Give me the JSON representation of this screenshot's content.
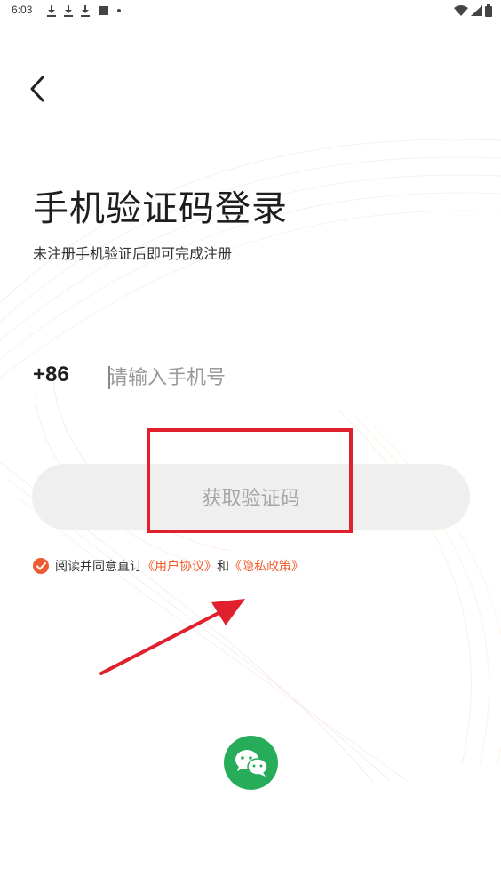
{
  "status_bar": {
    "time": "6:03",
    "left_icons": [
      "download-icon",
      "download-icon",
      "download-icon",
      "photo-icon",
      "dot-icon"
    ],
    "right_icons": [
      "wifi-icon",
      "signal-icon",
      "battery-icon"
    ]
  },
  "header": {
    "back_icon": "chevron-left-icon"
  },
  "login": {
    "title": "手机验证码登录",
    "subtitle": "未注册手机验证后即可完成注册",
    "country_code": "+86",
    "phone_placeholder": "请输入手机号",
    "get_code_label": "获取验证码"
  },
  "agreement": {
    "prefix": "阅读并同意直订",
    "user_agreement": "《用户协议》",
    "connector": "和",
    "privacy_policy": "《隐私政策》"
  },
  "social": {
    "wechat_icon": "wechat-icon"
  },
  "colors": {
    "accent": "#f05a2a",
    "check": "#ec5d34",
    "highlight": "#e0202c",
    "wechat": "#27ad5a",
    "button_bg": "#efefef"
  }
}
